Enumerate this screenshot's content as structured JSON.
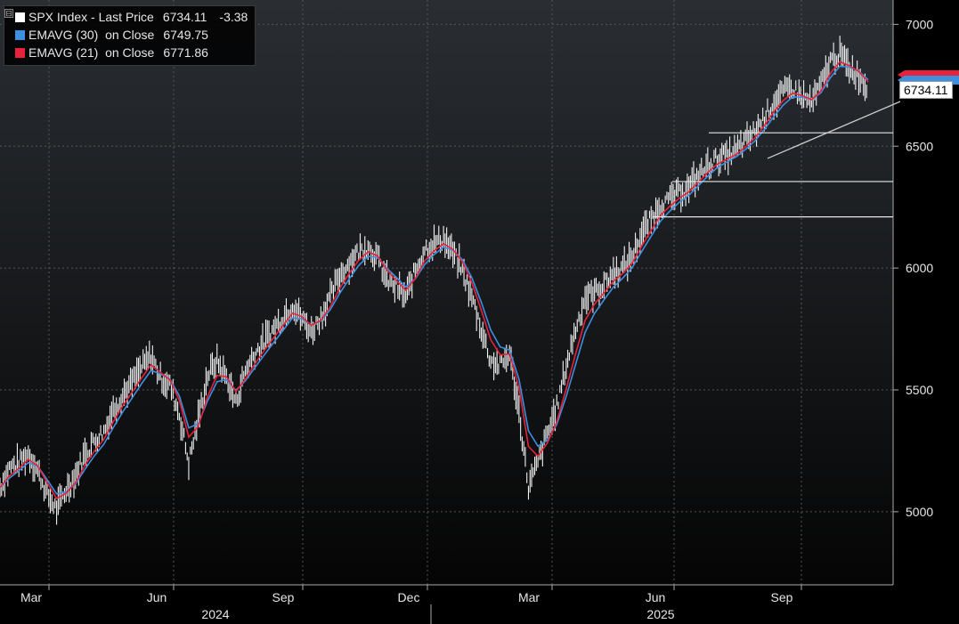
{
  "legend": {
    "collapse_glyph": "⊟",
    "items": [
      {
        "label": "SPX Index - Last Price",
        "value": "6734.11",
        "change": "-3.38",
        "color": "#ffffff"
      },
      {
        "label": "EMAVG (30)  on Close",
        "value": "6749.75",
        "change": "",
        "color": "#3d8fe0"
      },
      {
        "label": "EMAVG (21)  on Close",
        "value": "6771.86",
        "change": "",
        "color": "#e8223a"
      }
    ]
  },
  "last_price_tag": "6734.11",
  "chart_data": {
    "type": "line",
    "ylim": [
      4700,
      7100
    ],
    "yticks": [
      "5000",
      "5500",
      "6000",
      "6500",
      "7000"
    ],
    "x_month_labels": [
      "Mar",
      "Jun",
      "Sep",
      "Dec",
      "Mar",
      "Jun",
      "Sep"
    ],
    "x_year_labels": [
      "2024",
      "2025"
    ],
    "series": [
      {
        "name": "SPX Index - Last Price",
        "values": [
          5100,
          5180,
          5200,
          5240,
          5170,
          5070,
          5010,
          5090,
          5150,
          5240,
          5290,
          5330,
          5420,
          5480,
          5530,
          5590,
          5640,
          5550,
          5520,
          5400,
          5200,
          5380,
          5560,
          5620,
          5550,
          5450,
          5580,
          5650,
          5700,
          5750,
          5800,
          5850,
          5790,
          5740,
          5800,
          5880,
          5970,
          6020,
          6070,
          6090,
          6040,
          5950,
          5920,
          5880,
          5990,
          6080,
          6100,
          6120,
          6060,
          5990,
          5880,
          5750,
          5620,
          5600,
          5650,
          5410,
          5100,
          5200,
          5320,
          5430,
          5600,
          5750,
          5880,
          5900,
          5930,
          5980,
          6000,
          6050,
          6140,
          6200,
          6260,
          6280,
          6310,
          6330,
          6380,
          6420,
          6450,
          6460,
          6480,
          6520,
          6560,
          6620,
          6680,
          6720,
          6740,
          6700,
          6680,
          6750,
          6850,
          6880,
          6820,
          6790,
          6734
        ]
      },
      {
        "name": "EMAVG (30)",
        "values": [],
        "color": "#3d8fe0"
      },
      {
        "name": "EMAVG (21)",
        "values": [],
        "color": "#e8223a"
      }
    ],
    "horizontal_levels": [
      6555,
      6355,
      6210
    ],
    "trendline": [
      [
        6450,
        6440
      ],
      [
        6734,
        6720
      ]
    ],
    "grid": true
  }
}
